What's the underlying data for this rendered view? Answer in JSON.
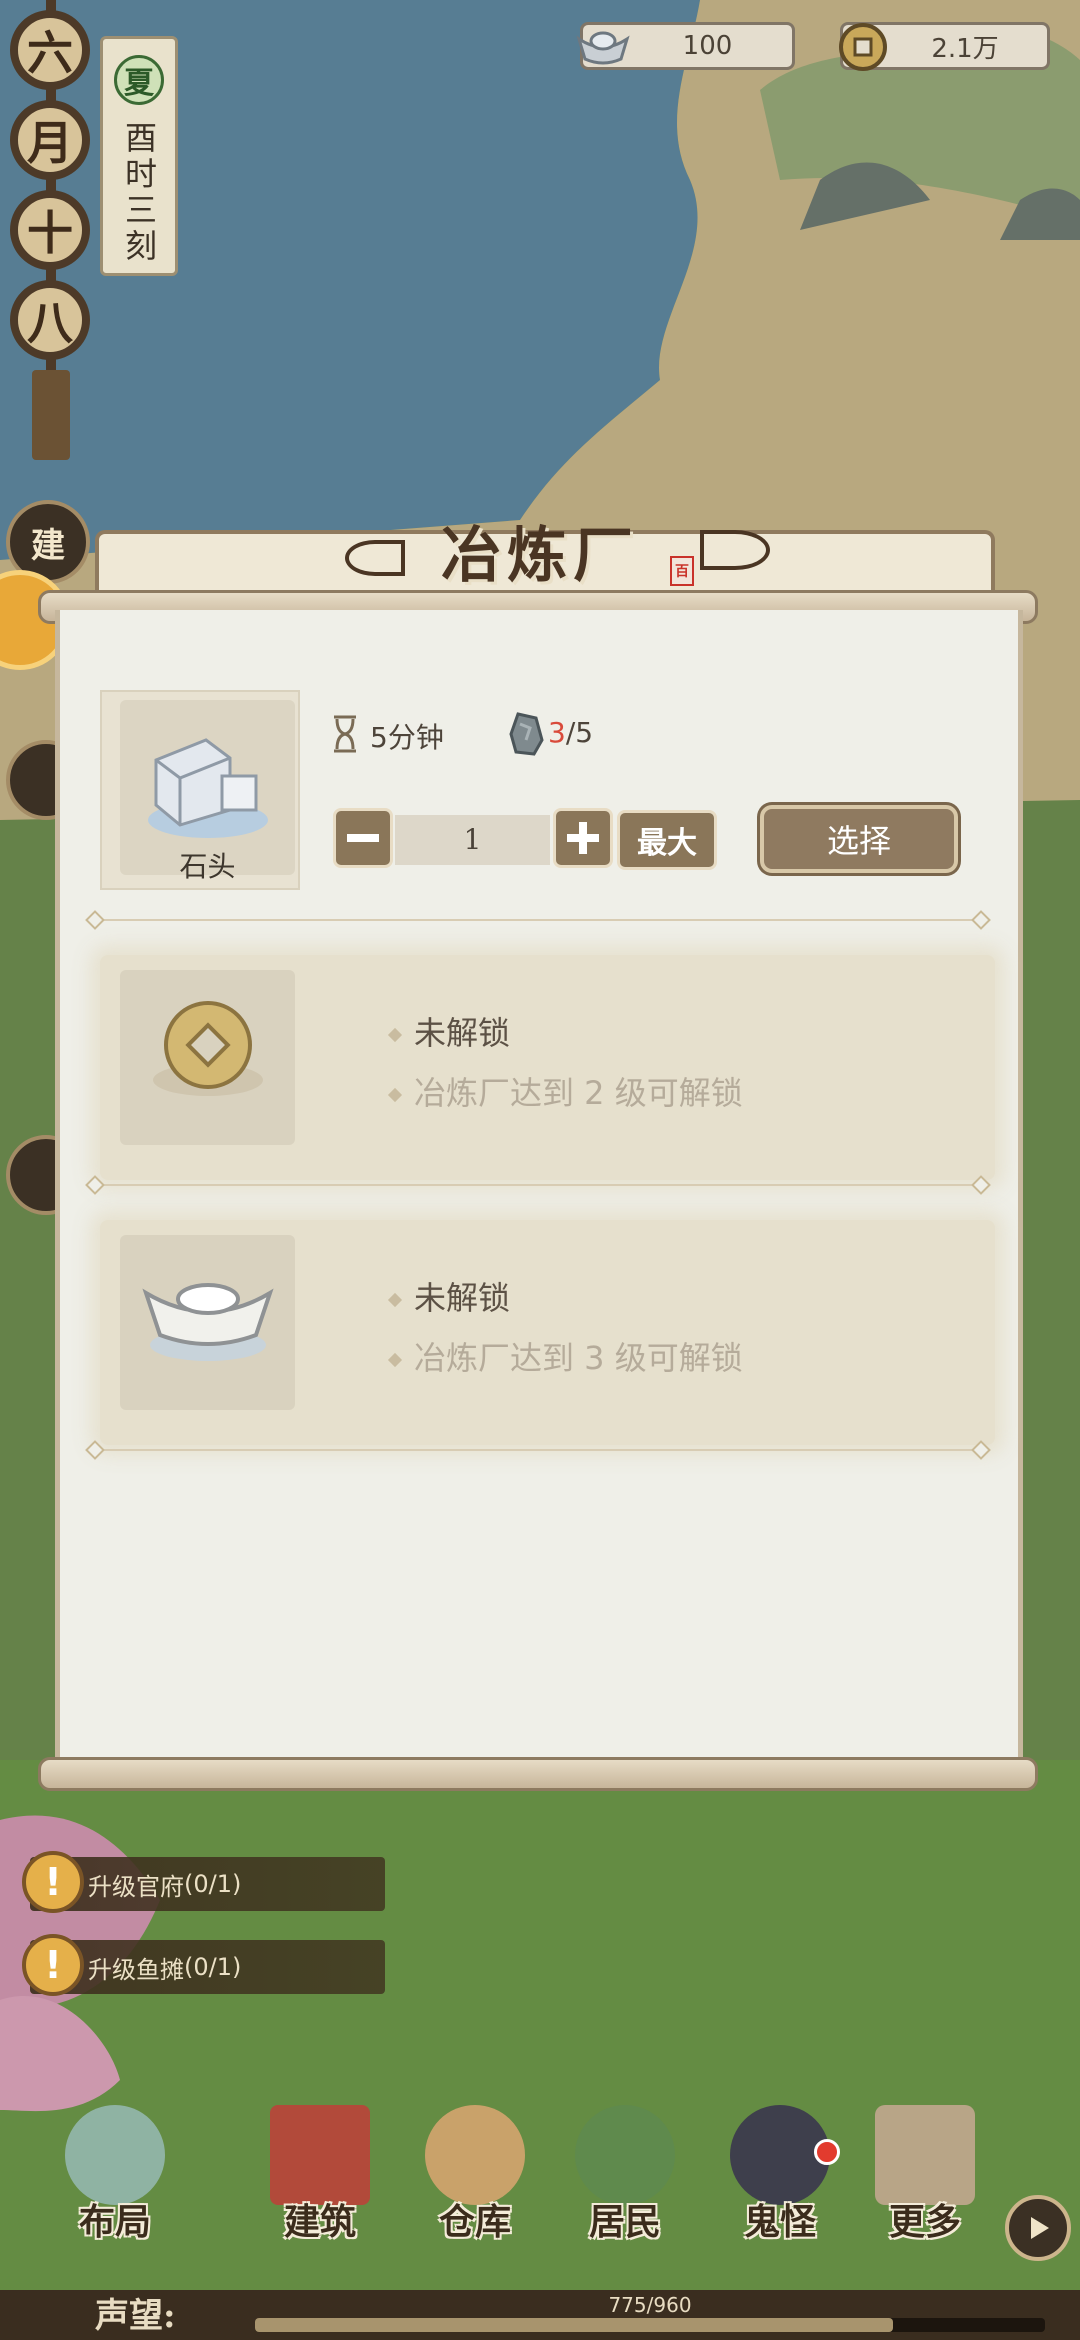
{
  "calendar": {
    "chars": [
      "六",
      "月",
      "十",
      "八"
    ],
    "season": "夏",
    "time": "酉时三刻"
  },
  "currency": {
    "silver": "100",
    "coins": "2.1万"
  },
  "side_buttons": {
    "build": "建"
  },
  "modal": {
    "title": "冶炼厂",
    "seal": "百",
    "recipe": {
      "item_name": "石头",
      "duration": "5分钟",
      "material_have": "3",
      "material_need": "/5",
      "quantity": "1",
      "max_label": "最大",
      "select_label": "选择"
    },
    "locked": [
      {
        "title": "未解锁",
        "desc": "冶炼厂达到 2 级可解锁",
        "icon": "copper-coin-icon"
      },
      {
        "title": "未解锁",
        "desc": "冶炼厂达到 3 级可解锁",
        "icon": "silver-ingot-icon"
      }
    ]
  },
  "quests": [
    {
      "label": "升级官府",
      "progress": "(0/1)"
    },
    {
      "label": "升级鱼摊",
      "progress": "(0/1)"
    }
  ],
  "nav": [
    {
      "label": "布局",
      "icon": "layout-icon"
    },
    {
      "label": "建筑",
      "icon": "building-icon"
    },
    {
      "label": "仓库",
      "icon": "warehouse-icon"
    },
    {
      "label": "居民",
      "icon": "residents-icon"
    },
    {
      "label": "鬼怪",
      "icon": "ghost-icon"
    },
    {
      "label": "更多",
      "icon": "more-icon"
    }
  ],
  "reputation": {
    "label": "声望:",
    "value": "775/960",
    "fraction": 0.807
  },
  "colors": {
    "panel": "#efefe8",
    "button": "#8a7659",
    "accent_red": "#d94a3a"
  }
}
